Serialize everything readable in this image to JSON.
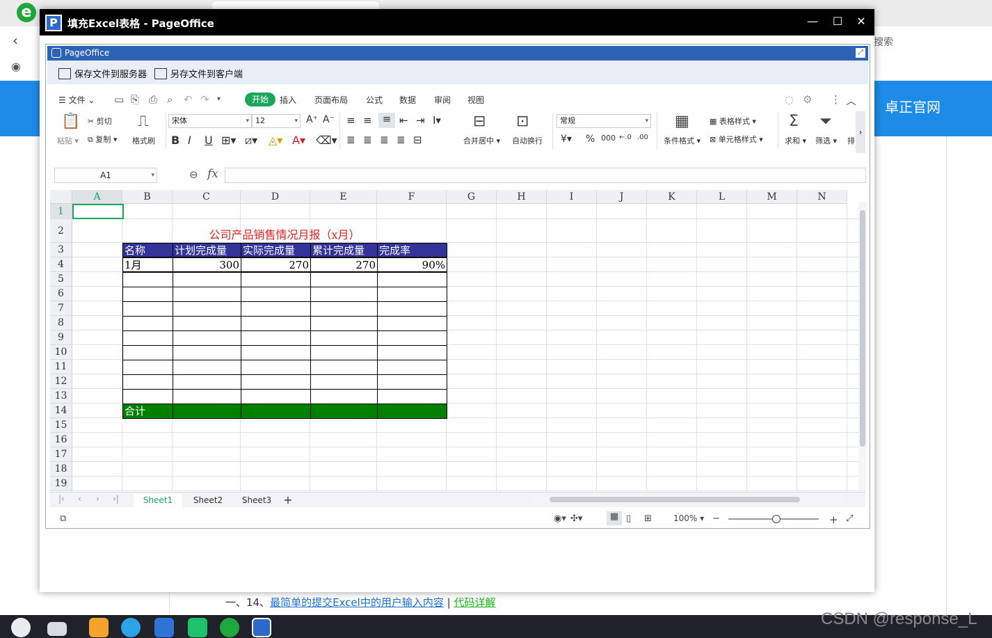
{
  "browser": {
    "search_hint": "搜索",
    "site_link": "卓正官网",
    "example_prefix": "一、14、",
    "example_link": "最简单的提交Excel中的用户输入内容",
    "example_sep": " | ",
    "example_code": "代码详解",
    "watermark": "CSDN @response_L"
  },
  "window": {
    "title": "填充Excel表格 - PageOffice",
    "minimize": "—",
    "maximize": "☐",
    "close": "✕"
  },
  "pageoffice": {
    "title": "PageOffice",
    "save_server": "保存文件到服务器",
    "save_client": "另存文件到客户端"
  },
  "menu": {
    "file": "文件",
    "tabs": [
      "开始",
      "插入",
      "页面布局",
      "公式",
      "数据",
      "审阅",
      "视图"
    ]
  },
  "ribbon": {
    "paste": "粘贴",
    "cut": "剪切",
    "copy": "复制",
    "format_painter": "格式刷",
    "font_name": "宋体",
    "font_size": "12",
    "merge_center": "合并居中",
    "wrap_text": "自动换行",
    "number_format": "常规",
    "cond_format": "条件格式",
    "table_style": "表格样式",
    "cell_style": "单元格样式",
    "sum": "求和",
    "filter": "筛选",
    "sort": "排"
  },
  "formula": {
    "cell_ref": "A1",
    "fx": "fx"
  },
  "sheet": {
    "columns": [
      "A",
      "B",
      "C",
      "D",
      "E",
      "F",
      "G",
      "H",
      "I",
      "J",
      "K",
      "L",
      "M",
      "N"
    ],
    "rows": [
      "1",
      "2",
      "3",
      "4",
      "5",
      "6",
      "7",
      "8",
      "9",
      "10",
      "11",
      "12",
      "13",
      "14",
      "15",
      "16",
      "17",
      "18",
      "19"
    ],
    "report_title": "公司产品销售情况月报（x月）",
    "headers": [
      "名称",
      "计划完成量",
      "实际完成量",
      "累计完成量",
      "完成率"
    ],
    "row4": [
      "1月",
      "300",
      "270",
      "270",
      "90%"
    ],
    "total_label": "合计"
  },
  "tabs": [
    "Sheet1",
    "Sheet2",
    "Sheet3"
  ],
  "status": {
    "zoom": "100%"
  }
}
